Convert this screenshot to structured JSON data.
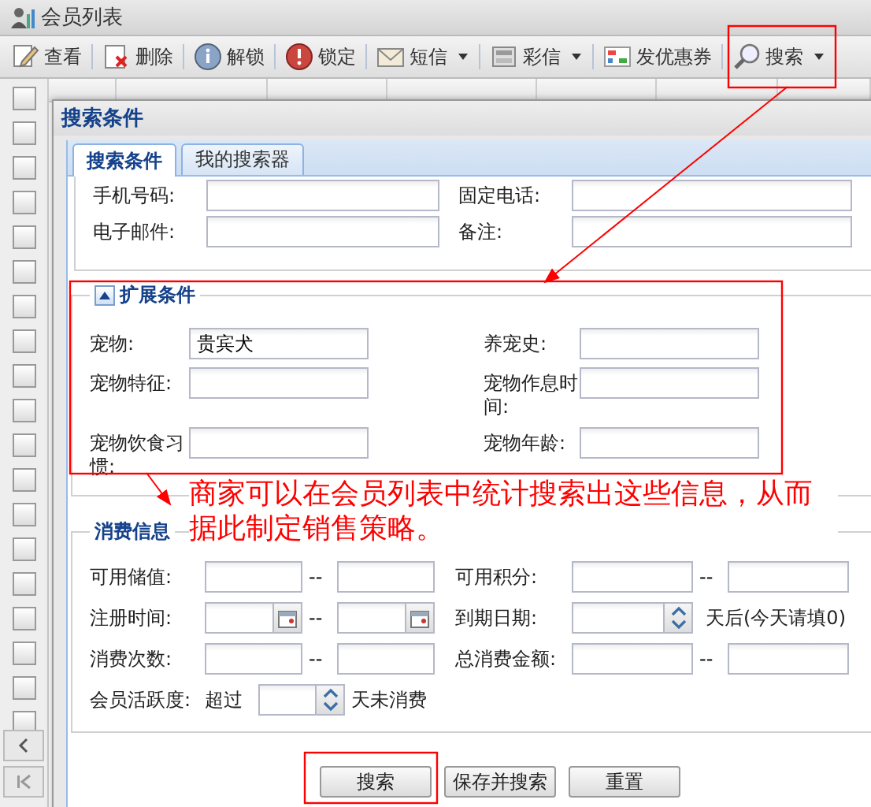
{
  "window": {
    "title": "会员列表"
  },
  "toolbar": [
    {
      "label": "查看",
      "kind": "plain"
    },
    {
      "label": "删除",
      "kind": "plain"
    },
    {
      "label": "解锁",
      "kind": "plain"
    },
    {
      "label": "锁定",
      "kind": "plain"
    },
    {
      "label": "短信",
      "kind": "dropdown"
    },
    {
      "label": "彩信",
      "kind": "dropdown"
    },
    {
      "label": "发优惠券",
      "kind": "plain"
    },
    {
      "label": "搜索",
      "kind": "dropdown"
    }
  ],
  "grid": {
    "rows": [
      {
        "checked": false
      },
      {
        "checked": false
      },
      {
        "checked": false
      },
      {
        "checked": false
      },
      {
        "checked": false
      },
      {
        "checked": false
      },
      {
        "checked": false
      },
      {
        "checked": false
      },
      {
        "checked": false
      },
      {
        "checked": false
      },
      {
        "checked": false
      },
      {
        "checked": false
      },
      {
        "checked": false
      },
      {
        "checked": false
      },
      {
        "checked": false
      },
      {
        "checked": false
      },
      {
        "checked": false
      },
      {
        "checked": false
      },
      {
        "checked": false
      }
    ]
  },
  "dialog": {
    "title": "搜索条件",
    "tabs": [
      {
        "label": "搜索条件",
        "selected": true
      },
      {
        "label": "我的搜索器",
        "selected": false
      }
    ],
    "basic_fields": [
      {
        "label": "手机号码:"
      },
      {
        "label": "固定电话:"
      },
      {
        "label": "电子邮件:"
      },
      {
        "label": "备注:"
      }
    ],
    "extended": {
      "legend": "扩展条件",
      "expanded": true,
      "fields": [
        {
          "label": "宠物:",
          "value": "贵宾犬"
        },
        {
          "label": "养宠史:"
        },
        {
          "label": "宠物特征:"
        },
        {
          "label": "宠物作息时间:"
        },
        {
          "label": "宠物饮食习惯:"
        },
        {
          "label": "宠物年龄:"
        }
      ]
    },
    "consumption": {
      "legend": "消费信息",
      "fields": [
        {
          "label": "可用储值:",
          "kind": "range",
          "separator": "--"
        },
        {
          "label": "可用积分:",
          "kind": "range",
          "separator": "--"
        },
        {
          "label": "注册时间:",
          "kind": "date_range",
          "separator": "--"
        },
        {
          "label": "到期日期:",
          "kind": "spinner",
          "suffix": "天后(今天请填0)"
        },
        {
          "label": "消费次数:",
          "kind": "range",
          "separator": "--"
        },
        {
          "label": "总消费金额:",
          "kind": "range",
          "separator": "--"
        },
        {
          "label": "会员活跃度:",
          "kind": "spinner",
          "prefix": "超过",
          "suffix": "天未消费"
        }
      ]
    },
    "buttons": [
      {
        "label": "搜索"
      },
      {
        "label": "保存并搜索"
      },
      {
        "label": "重置"
      }
    ]
  },
  "annotation": {
    "note": "商家可以在会员列表中统计搜索出这些信息，从而据此制定销售策略。"
  }
}
